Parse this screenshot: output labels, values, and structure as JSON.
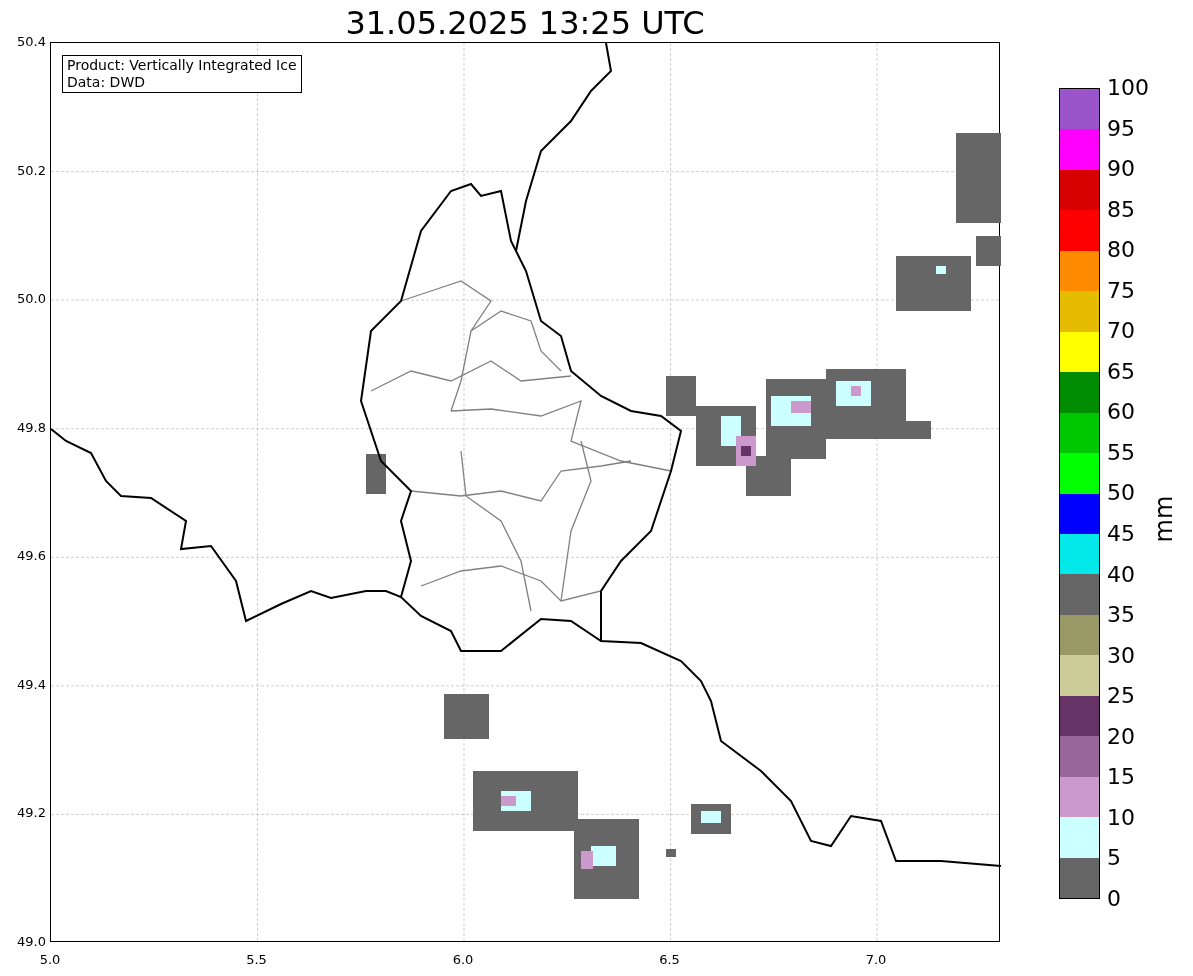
{
  "title": "31.05.2025 13:25 UTC",
  "info_box": [
    "Product: Vertically Integrated Ice",
    "Data: DWD"
  ],
  "x_ticks": [
    "5.0",
    "5.5",
    "6.0",
    "6.5",
    "7.0"
  ],
  "y_ticks": [
    "50.4",
    "50.2",
    "50.0",
    "49.8",
    "49.6",
    "49.4",
    "49.2",
    "49.0"
  ],
  "colorbar": {
    "label": "mm",
    "ticks": [
      "100",
      "95",
      "90",
      "85",
      "80",
      "75",
      "70",
      "65",
      "60",
      "55",
      "50",
      "45",
      "40",
      "35",
      "30",
      "25",
      "20",
      "15",
      "10",
      "5",
      "0"
    ],
    "segments": [
      {
        "color": "#9955c9"
      },
      {
        "color": "#ff00ff"
      },
      {
        "color": "#d60000"
      },
      {
        "color": "#ff0000"
      },
      {
        "color": "#ff8c00"
      },
      {
        "color": "#e5bc00"
      },
      {
        "color": "#ffff00"
      },
      {
        "color": "#008c00"
      },
      {
        "color": "#00c800"
      },
      {
        "color": "#00ff00"
      },
      {
        "color": "#0000ff"
      },
      {
        "color": "#00e8e8"
      },
      {
        "color": "#666666"
      },
      {
        "color": "#999966"
      },
      {
        "color": "#cccc99"
      },
      {
        "color": "#663366"
      },
      {
        "color": "#996699"
      },
      {
        "color": "#cc99cc"
      },
      {
        "color": "#ccffff"
      },
      {
        "color": "#666666"
      }
    ]
  }
}
